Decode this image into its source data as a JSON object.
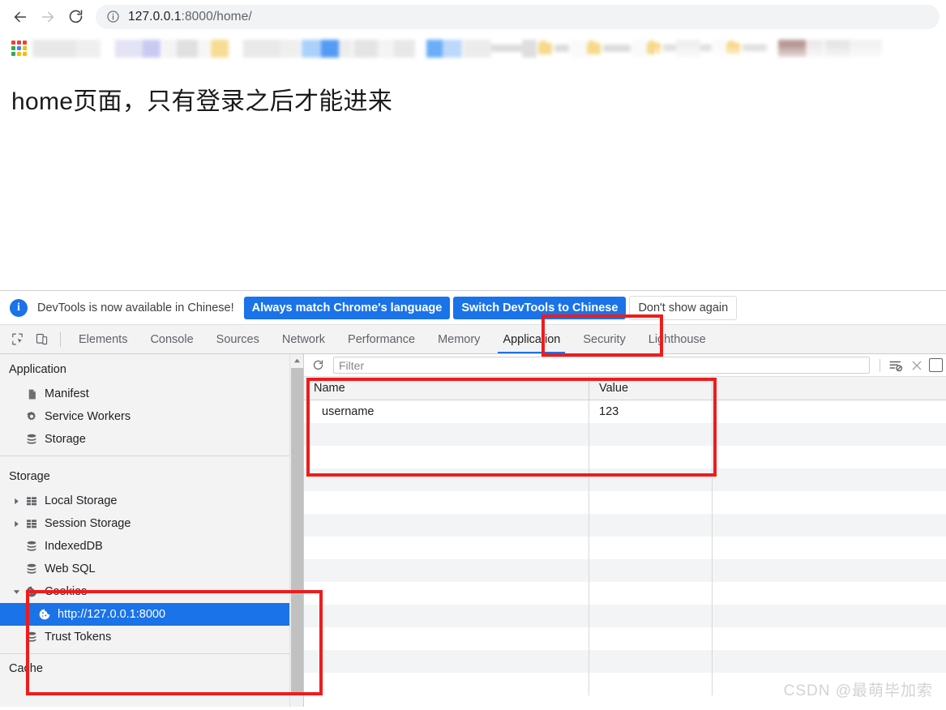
{
  "browser": {
    "back_label": "Back",
    "forward_label": "Forward",
    "reload_label": "Reload",
    "site_info_icon": "info-circle-icon",
    "url": "127.0.0.1:8000/home/",
    "url_host": "127.0.0.1",
    "url_rest": ":8000/home/",
    "apps_grid_label": "Apps"
  },
  "page": {
    "heading": "home页面，只有登录之后才能进来"
  },
  "devtools": {
    "notice": {
      "icon": "info-icon",
      "text": "DevTools is now available in Chinese!",
      "primary_button": "Always match Chrome's language",
      "secondary_button": "Switch DevTools to Chinese",
      "dismiss_button": "Don't show again"
    },
    "toolbar_icons": [
      {
        "name": "inspect-element-icon"
      },
      {
        "name": "device-toolbar-icon"
      }
    ],
    "tabs": [
      {
        "label": "Elements",
        "active": false
      },
      {
        "label": "Console",
        "active": false
      },
      {
        "label": "Sources",
        "active": false
      },
      {
        "label": "Network",
        "active": false
      },
      {
        "label": "Performance",
        "active": false
      },
      {
        "label": "Memory",
        "active": false
      },
      {
        "label": "Application",
        "active": true
      },
      {
        "label": "Security",
        "active": false
      },
      {
        "label": "Lighthouse",
        "active": false
      }
    ],
    "sidebar": {
      "application_section": {
        "title": "Application",
        "items": [
          {
            "label": "Manifest",
            "icon": "manifest-document-icon",
            "expandable": false
          },
          {
            "label": "Service Workers",
            "icon": "gear-icon",
            "expandable": false
          },
          {
            "label": "Storage",
            "icon": "database-icon",
            "expandable": false
          }
        ]
      },
      "storage_section": {
        "title": "Storage",
        "items": [
          {
            "label": "Local Storage",
            "icon": "table-grid-icon",
            "expandable": true,
            "expanded": false
          },
          {
            "label": "Session Storage",
            "icon": "table-grid-icon",
            "expandable": true,
            "expanded": false
          },
          {
            "label": "IndexedDB",
            "icon": "database-icon",
            "expandable": false
          },
          {
            "label": "Web SQL",
            "icon": "database-icon",
            "expandable": false
          },
          {
            "label": "Cookies",
            "icon": "cookie-icon",
            "expandable": true,
            "expanded": true
          },
          {
            "label": "http://127.0.0.1:8000",
            "icon": "cookie-icon",
            "expandable": false,
            "selected": true,
            "child": true
          },
          {
            "label": "Trust Tokens",
            "icon": "database-icon",
            "expandable": false
          }
        ]
      },
      "cache_section": {
        "title": "Cache"
      }
    },
    "filter_bar": {
      "refresh_icon": "refresh-icon",
      "filter_placeholder": "Filter",
      "filter_value": "",
      "clear_filtered_icon": "clear-filtered-cookies-icon",
      "clear_all_icon": "close-x-icon",
      "checkbox_label": "only-show-problematic-cookies-checkbox"
    },
    "cookies_table": {
      "columns": [
        "Name",
        "Value"
      ],
      "rows": [
        {
          "name": "username",
          "value": "123"
        },
        {
          "name": "",
          "value": ""
        },
        {
          "name": "",
          "value": ""
        }
      ]
    }
  },
  "annotations": {
    "accent_color": "#ee1c1c",
    "boxes": [
      {
        "name": "application-tab-highlight"
      },
      {
        "name": "cookies-table-highlight"
      },
      {
        "name": "cookies-tree-highlight"
      }
    ]
  },
  "watermark": "CSDN @最萌毕加索"
}
